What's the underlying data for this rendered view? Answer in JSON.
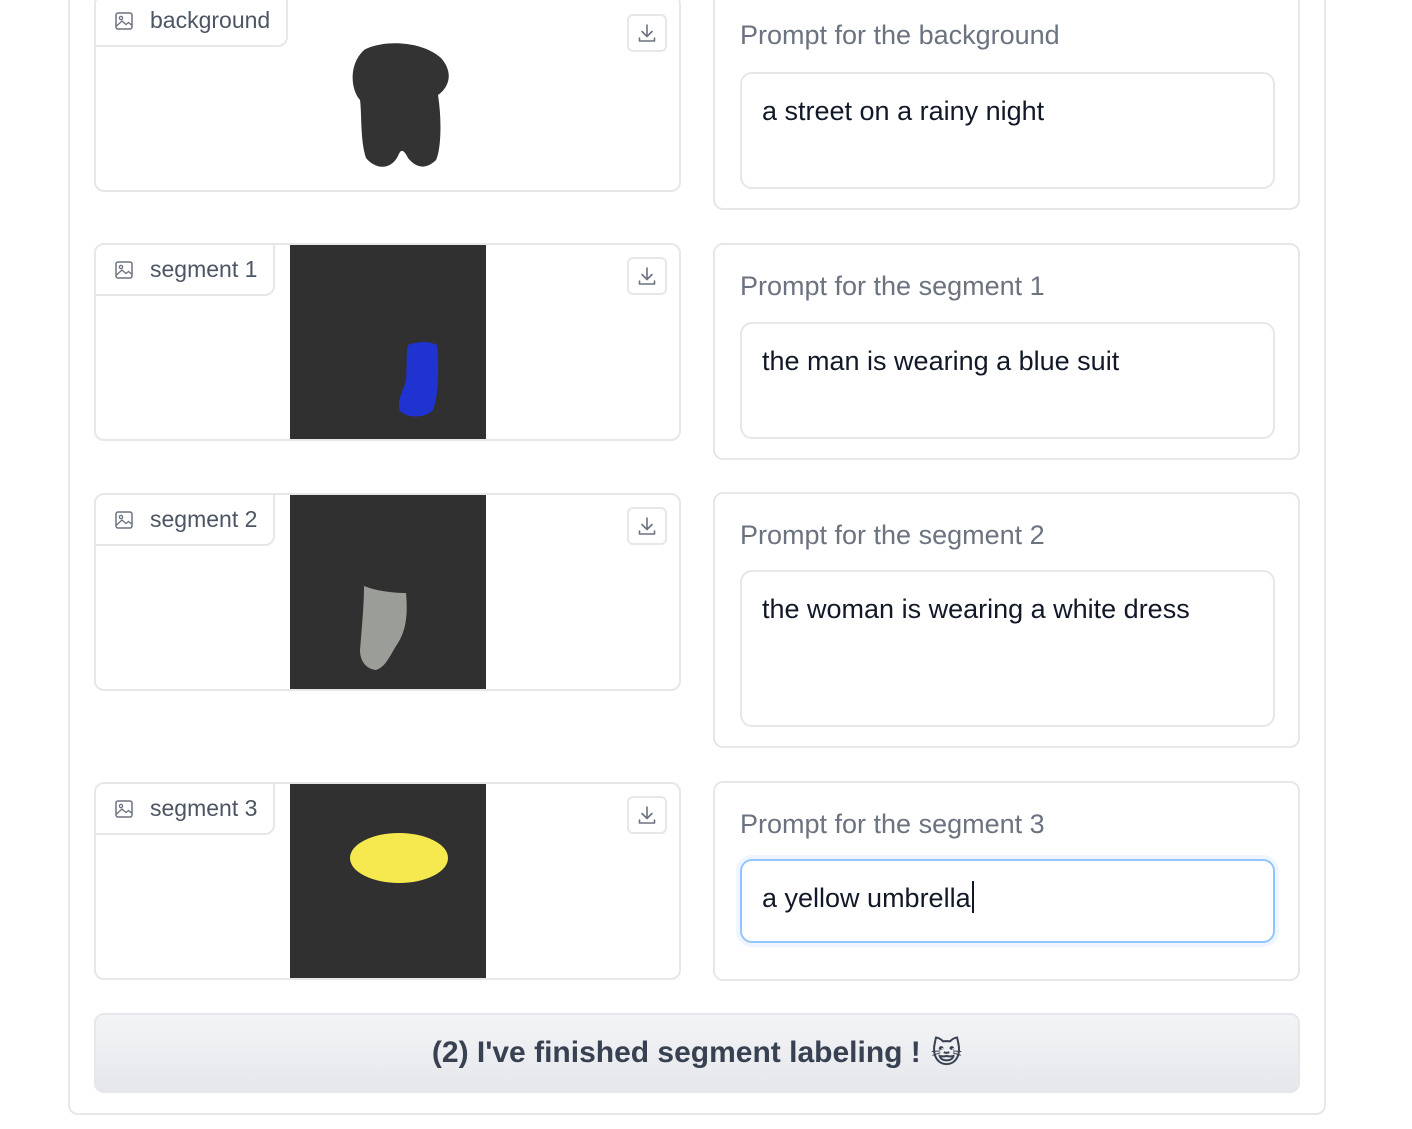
{
  "rows": [
    {
      "image_label": "background",
      "prompt_label": "Prompt for the background",
      "prompt_value": "a street on a rainy night"
    },
    {
      "image_label": "segment 1",
      "prompt_label": "Prompt for the segment 1",
      "prompt_value": "the man is wearing a blue suit",
      "mask_color": "#1f33d1"
    },
    {
      "image_label": "segment 2",
      "prompt_label": "Prompt for the segment 2",
      "prompt_value": "the woman is wearing a white dress",
      "mask_color": "#9a9d98"
    },
    {
      "image_label": "segment 3",
      "prompt_label": "Prompt for the segment 3",
      "prompt_value": "a yellow umbrella",
      "mask_color": "#f5e94f"
    }
  ],
  "finish_button": {
    "label": "(2) I've finished segment labeling !",
    "emoji": "😺"
  },
  "colors": {
    "border": "#e5e7eb",
    "mask_bg": "#303030",
    "focus": "#93c5fd"
  }
}
